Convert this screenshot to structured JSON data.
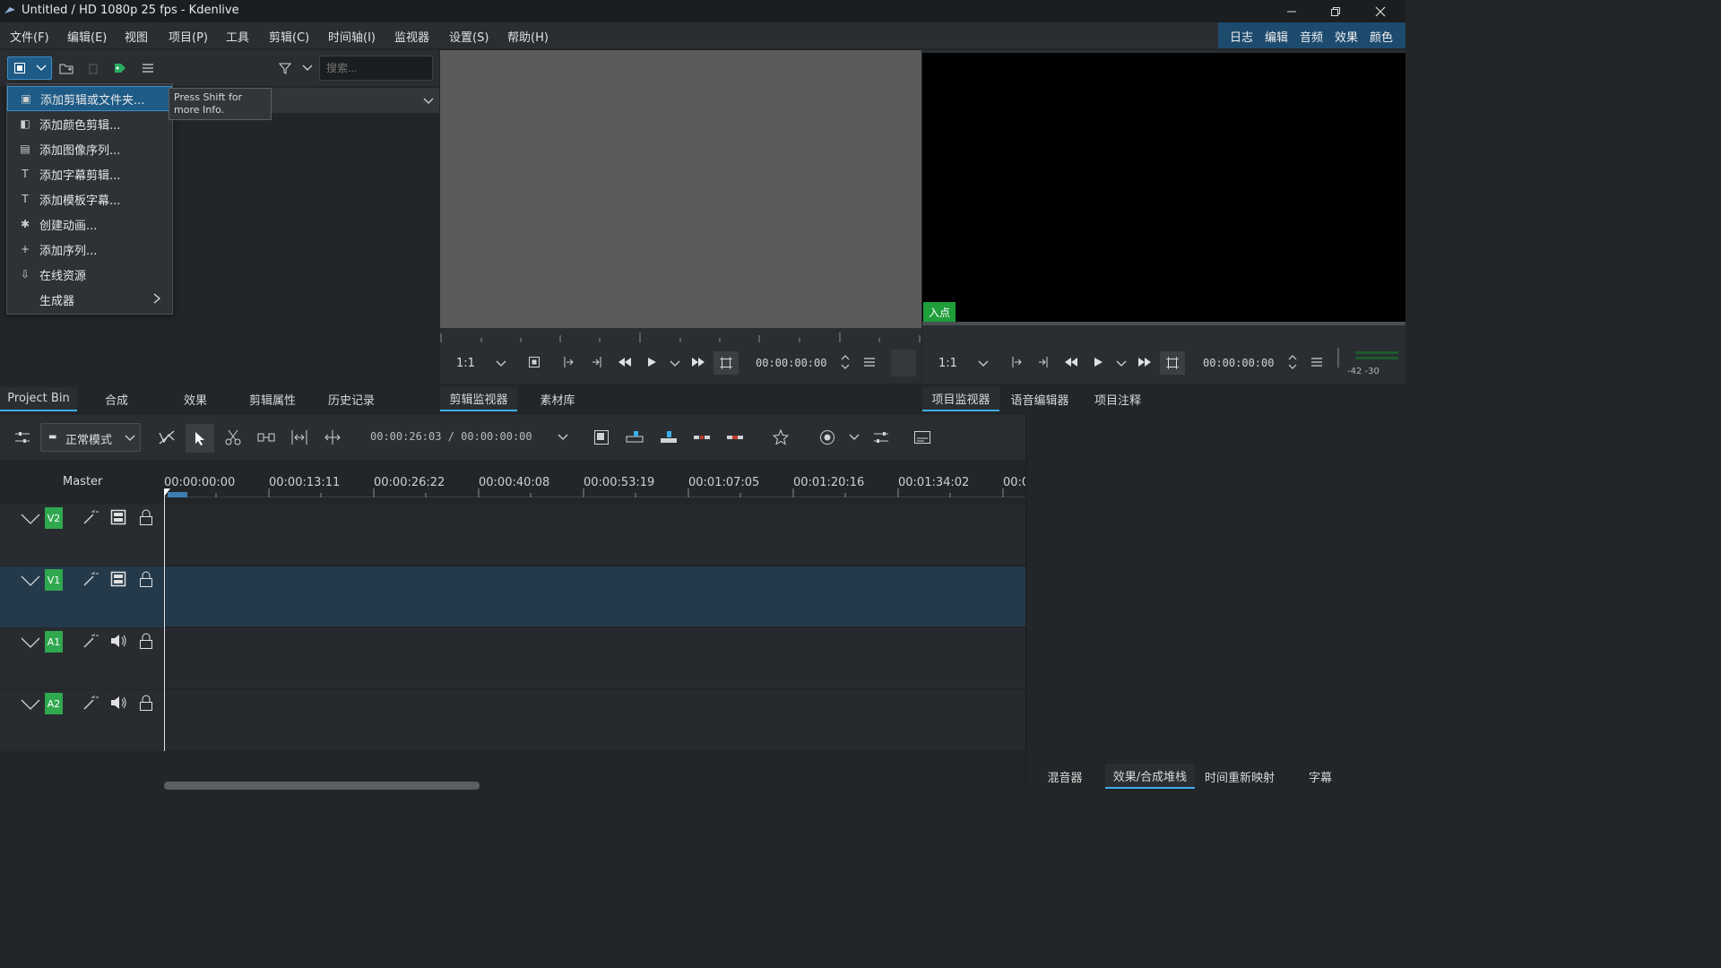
{
  "window": {
    "title": "Untitled / HD 1080p 25 fps - Kdenlive"
  },
  "menu": [
    "文件(F)",
    "编辑(E)",
    "视图",
    "项目(P)",
    "工具",
    "剪辑(C)",
    "时间轴(I)",
    "监视器",
    "设置(S)",
    "帮助(H)"
  ],
  "layouts": [
    "日志",
    "编辑",
    "音频",
    "效果",
    "颜色"
  ],
  "bin": {
    "search_placeholder": "搜索...",
    "context_menu": [
      {
        "label": "添加剪辑或文件夹...",
        "icon": "add-clip-icon"
      },
      {
        "label": "添加颜色剪辑...",
        "icon": "color-clip-icon"
      },
      {
        "label": "添加图像序列...",
        "icon": "image-sequence-icon"
      },
      {
        "label": "添加字幕剪辑...",
        "icon": "title-clip-icon"
      },
      {
        "label": "添加模板字幕...",
        "icon": "template-title-icon"
      },
      {
        "label": "创建动画...",
        "icon": "animation-icon"
      },
      {
        "label": "添加序列...",
        "icon": "add-sequence-icon"
      },
      {
        "label": "在线资源",
        "icon": "download-icon"
      },
      {
        "label": "生成器",
        "icon": ""
      }
    ],
    "tooltip": "Press Shift for more Info.",
    "tabs": [
      "Project Bin",
      "合成",
      "效果",
      "剪辑属性",
      "历史记录"
    ]
  },
  "clip_monitor": {
    "zoom": "1:1",
    "timecode": "00:00:00:00",
    "tabs": [
      "剪辑监视器",
      "素材库"
    ]
  },
  "project_monitor": {
    "in_point_label": "入点",
    "zoom": "1:1",
    "timecode": "00:00:00:00",
    "audio_levels": "-42 -30",
    "tabs": [
      "项目监视器",
      "语音编辑器",
      "项目注释"
    ]
  },
  "timeline": {
    "mode": "正常模式",
    "timecode": "00:00:26:03 / 00:00:00:00",
    "master_label": "Master",
    "ruler": [
      "00:00:00:00",
      "00:00:13:11",
      "00:00:26:22",
      "00:00:40:08",
      "00:00:53:19",
      "00:01:07:05",
      "00:01:20:16",
      "00:01:34:02",
      "00:0"
    ],
    "tracks": [
      {
        "name": "V2",
        "kind": "video"
      },
      {
        "name": "V1",
        "kind": "video"
      },
      {
        "name": "A1",
        "kind": "audio"
      },
      {
        "name": "A2",
        "kind": "audio"
      }
    ]
  },
  "right_tabs": [
    "混音器",
    "效果/合成堆栈",
    "时间重新映射",
    "字幕"
  ],
  "colors": {
    "accent": "#3daee9",
    "track_badge": "#2fa84f",
    "selected_track": "#243a4a"
  }
}
